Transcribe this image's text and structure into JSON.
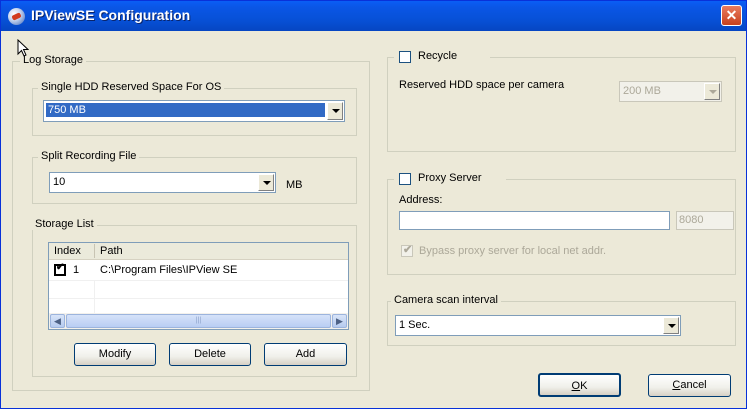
{
  "window": {
    "title": "IPViewSE Configuration",
    "close_glyph": "✕"
  },
  "log_storage": {
    "label": "Log Storage",
    "hdd_reserved": {
      "label": "Single HDD Reserved Space For OS",
      "value": "750 MB"
    },
    "split_recording": {
      "label": "Split Recording File",
      "value": "10",
      "unit": "MB"
    },
    "storage_list": {
      "label": "Storage List",
      "columns": [
        "Index",
        "Path"
      ],
      "rows": [
        {
          "checked": true,
          "index": "1",
          "path": "C:\\Program Files\\IPView SE"
        }
      ],
      "scroll_thumb_glyph": "III"
    },
    "buttons": {
      "modify": "Modify",
      "delete": "Delete",
      "add": "Add"
    }
  },
  "recycle": {
    "label": "Recycle",
    "checked": false,
    "reserved_label": "Reserved HDD space per camera",
    "reserved_value": "200 MB"
  },
  "proxy": {
    "label": "Proxy Server",
    "checked": false,
    "address_label": "Address:",
    "address_value": "",
    "port_value": "8080",
    "bypass_label": "Bypass proxy server for local net addr.",
    "bypass_checked": true
  },
  "camera_scan": {
    "label": "Camera scan interval",
    "value": "1 Sec."
  },
  "dialog_buttons": {
    "ok_label": "OK",
    "ok_mnemonic": "O",
    "ok_rest": "K",
    "cancel_label": "Cancel",
    "cancel_mnemonic": "C",
    "cancel_rest": "ancel"
  },
  "colors": {
    "title_bar": "#0a5ef5",
    "selection": "#316ac5",
    "dialog_bg": "#ece9d8"
  }
}
